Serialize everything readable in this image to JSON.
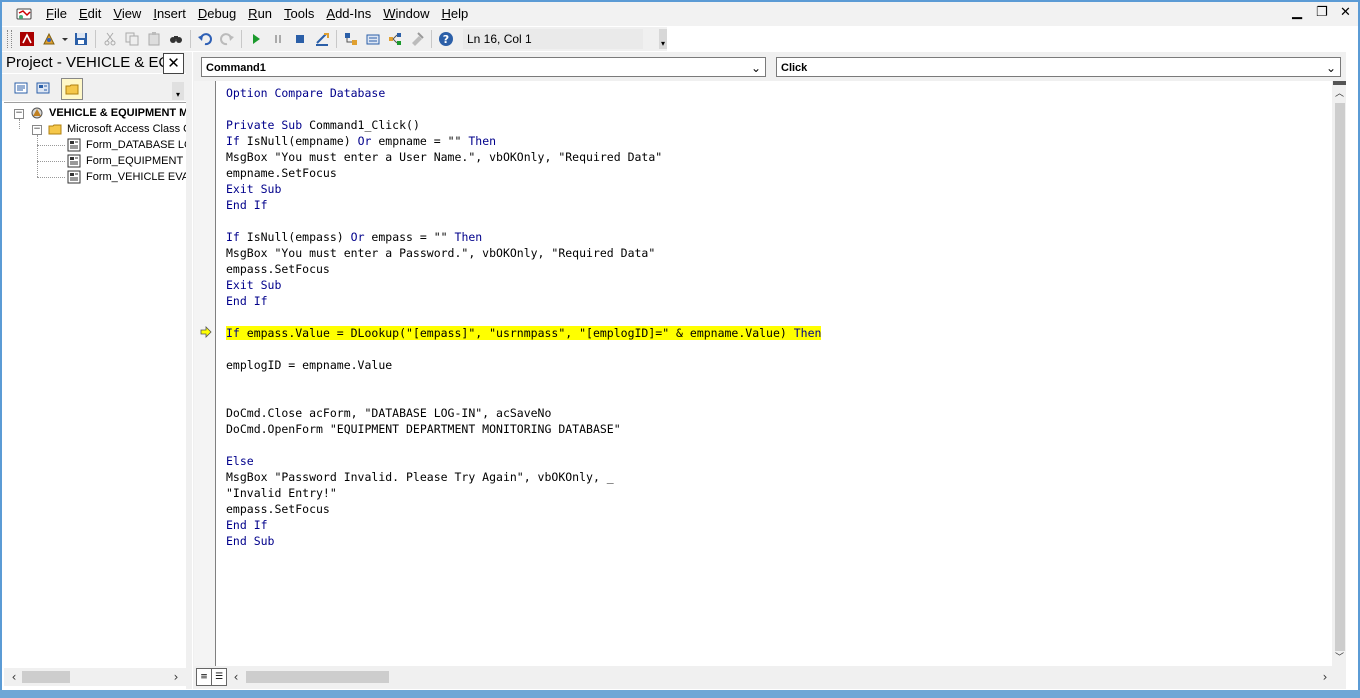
{
  "menu": {
    "items": [
      {
        "label": "File",
        "u": "F",
        "rest": "ile"
      },
      {
        "label": "Edit",
        "u": "E",
        "rest": "dit"
      },
      {
        "label": "View",
        "u": "V",
        "rest": "iew"
      },
      {
        "label": "Insert",
        "u": "I",
        "rest": "nsert"
      },
      {
        "label": "Debug",
        "u": "D",
        "rest": "ebug"
      },
      {
        "label": "Run",
        "u": "R",
        "rest": "un"
      },
      {
        "label": "Tools",
        "u": "T",
        "rest": "ools"
      },
      {
        "label": "Add-Ins",
        "u": "A",
        "rest": "dd-Ins"
      },
      {
        "label": "Window",
        "u": "W",
        "rest": "indow"
      },
      {
        "label": "Help",
        "u": "H",
        "rest": "elp"
      }
    ],
    "minimize": "▁",
    "restore": "❐",
    "close": "✕"
  },
  "toolbar": {
    "position": "Ln 16, Col 1"
  },
  "project": {
    "title": "Project - VEHICLE & EQUIPMENT",
    "close": "✕",
    "tree": {
      "root": "VEHICLE & EQUIPMENT MONITORING DATABASE",
      "folder": "Microsoft Access Class Objects",
      "items": [
        "Form_DATABASE LOG-IN",
        "Form_EQUIPMENT DEPARTMENT",
        "Form_VEHICLE EVALUATION"
      ]
    }
  },
  "code_window": {
    "object_combo": "Command1",
    "proc_combo": "Click",
    "lines": [
      "Option Compare Database",
      "",
      "Private Sub Command1_Click()",
      "If IsNull(empname) Or empname = \"\" Then",
      "MsgBox \"You must enter a User Name.\", vbOKOnly, \"Required Data\"",
      "empname.SetFocus",
      "Exit Sub",
      "End If",
      "",
      "If IsNull(empass) Or empass = \"\" Then",
      "MsgBox \"You must enter a Password.\", vbOKOnly, \"Required Data\"",
      "empass.SetFocus",
      "Exit Sub",
      "End If",
      "",
      "If empass.Value = DLookup(\"[empass]\", \"usrnmpass\", \"[emplogID]=\" & empname.Value) Then",
      "",
      "emplogID = empname.Value",
      "",
      "",
      "DoCmd.Close acForm, \"DATABASE LOG-IN\", acSaveNo",
      "DoCmd.OpenForm \"EQUIPMENT DEPARTMENT MONITORING DATABASE\"",
      "",
      "Else",
      "MsgBox \"Password Invalid. Please Try Again\", vbOKOnly, _",
      "\"Invalid Entry!\"",
      "empass.SetFocus",
      "End If",
      "End Sub"
    ],
    "highlighted_line": 15
  },
  "colors": {
    "keyword": "#00008b",
    "highlight": "#ffff00",
    "accent": "#5b9bd5"
  }
}
